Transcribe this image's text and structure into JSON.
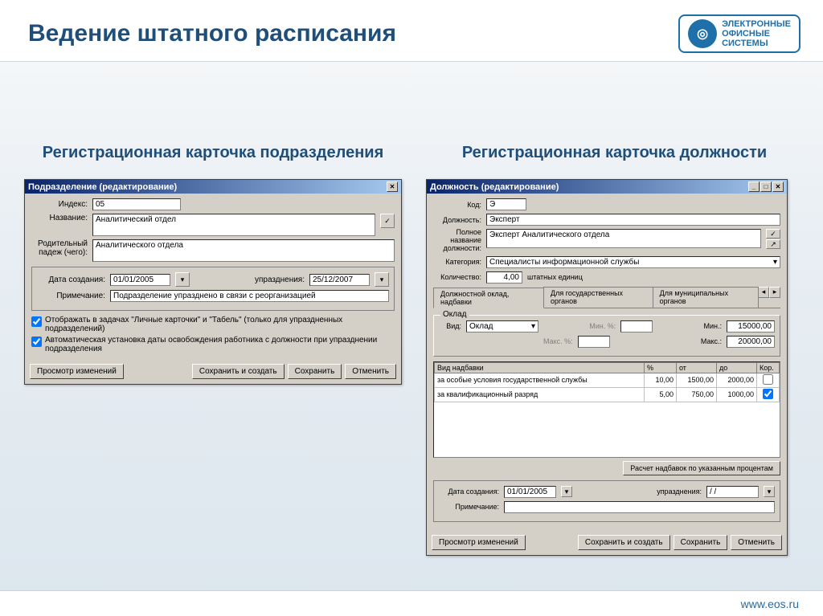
{
  "slide": {
    "title": "Ведение штатного расписания",
    "logo_lines": [
      "ЭЛЕКТРОННЫЕ",
      "ОФИСНЫЕ",
      "СИСТЕМЫ"
    ],
    "footer_url": "www.eos.ru"
  },
  "left": {
    "section_title": "Регистрационная карточка подразделения",
    "window_title": "Подразделение (редактирование)",
    "index_label": "Индекс:",
    "index_value": "05",
    "name_label": "Название:",
    "name_value": "Аналитический отдел",
    "genitive_label": "Родительный падеж (чего):",
    "genitive_value": "Аналитического отдела",
    "date_created_label": "Дата создания:",
    "date_created_value": "01/01/2005",
    "date_closed_label": "упразднения:",
    "date_closed_value": "25/12/2007",
    "note_label": "Примечание:",
    "note_value": "Подразделение упразднено в связи с реорганизацией",
    "cb1": "Отображать в задачах \"Личные карточки\" и \"Табель\" (только для упраздненных подразделений)",
    "cb2": "Автоматическая установка даты освобождения работника с должности при упразднении подразделения",
    "buttons": {
      "view": "Просмотр изменений",
      "save_create": "Сохранить и создать",
      "save": "Сохранить",
      "cancel": "Отменить"
    }
  },
  "right": {
    "section_title": "Регистрационная карточка должности",
    "window_title": "Должность (редактирование)",
    "code_label": "Код:",
    "code_value": "Э",
    "position_label": "Должность:",
    "position_value": "Эксперт",
    "fullname_label": "Полное название должности:",
    "fullname_value": "Эксперт  Аналитического отдела",
    "category_label": "Категория:",
    "category_value": "Специалисты информационной службы",
    "qty_label": "Количество:",
    "qty_value": "4,00",
    "qty_units": "штатных единиц",
    "tabs": [
      "Должностной оклад, надбавки",
      "Для государственных органов",
      "Для муниципальных органов"
    ],
    "salary_group": "Оклад",
    "kind_label": "Вид:",
    "kind_value": "Оклад",
    "min_pct": "Мин. %:",
    "max_pct": "Макс. %:",
    "min_label": "Мин.:",
    "min_value": "15000,00",
    "max_label": "Макс.:",
    "max_value": "20000,00",
    "grid_headers": [
      "Вид надбавки",
      "%",
      "от",
      "до",
      "Кор."
    ],
    "grid_rows": [
      {
        "name": "за особые условия государственной службы",
        "pct": "10,00",
        "from": "1500,00",
        "to": "2000,00",
        "kor": false
      },
      {
        "name": "за квалификационный разряд",
        "pct": "5,00",
        "from": "750,00",
        "to": "1000,00",
        "kor": true
      }
    ],
    "calc_btn": "Расчет надбавок по указанным процентам",
    "date_created_label": "Дата создания:",
    "date_created_value": "01/01/2005",
    "date_closed_label": "упразднения:",
    "date_closed_value": "/ /",
    "note_label": "Примечание:",
    "note_value": "",
    "buttons": {
      "view": "Просмотр изменений",
      "save_create": "Сохранить и создать",
      "save": "Сохранить",
      "cancel": "Отменить"
    }
  }
}
